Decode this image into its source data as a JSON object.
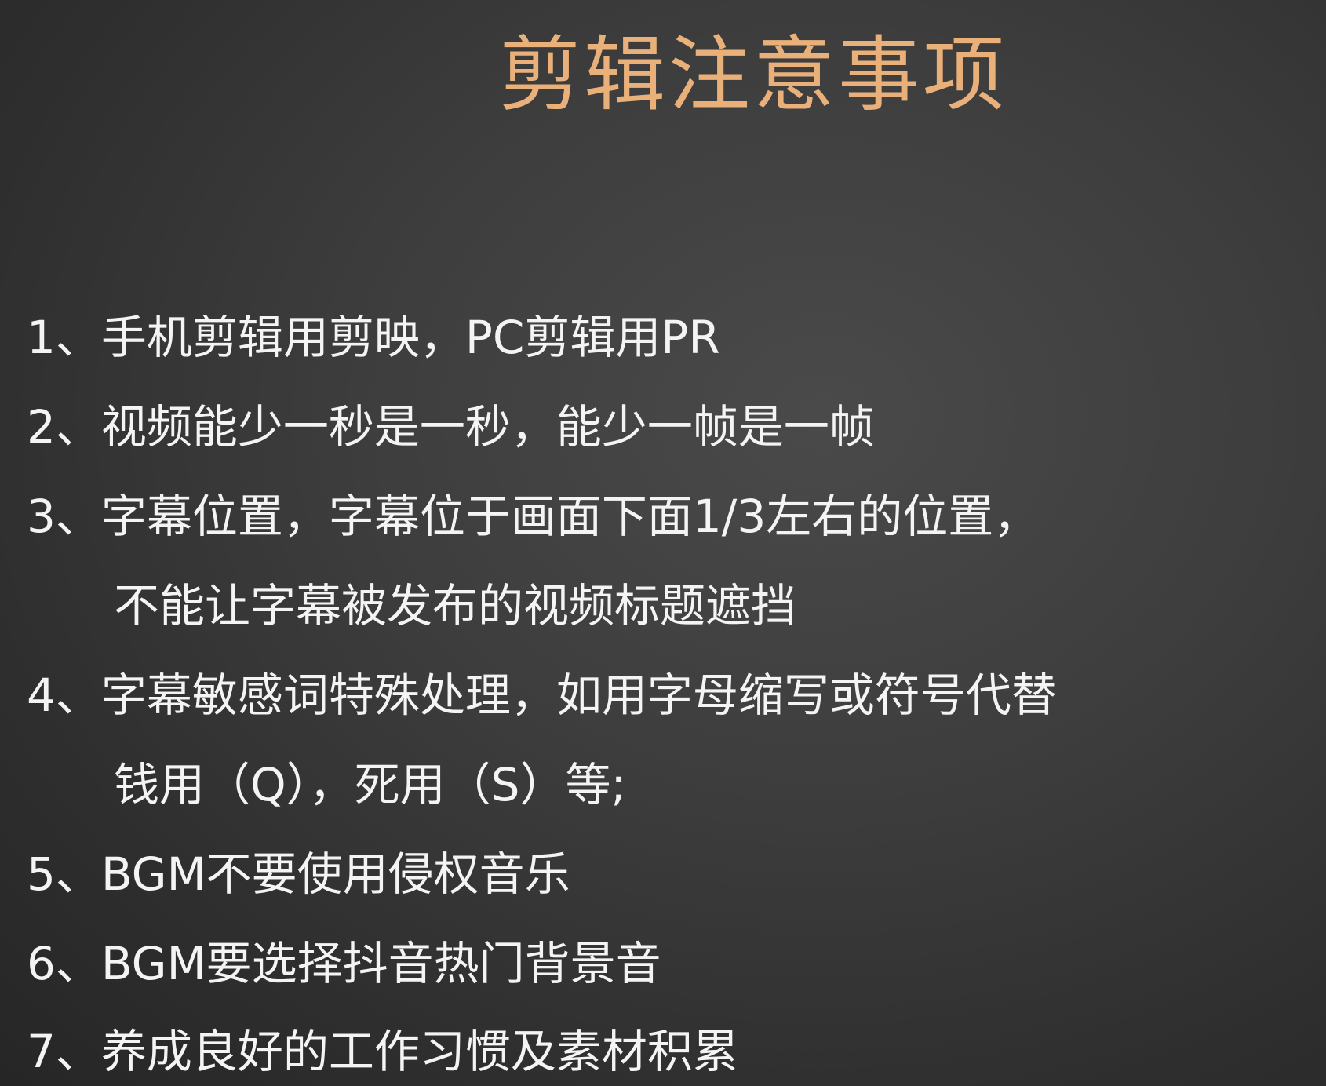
{
  "slide": {
    "title": "剪辑注意事项",
    "items": [
      {
        "text": "1、手机剪辑用剪映，PC剪辑用PR"
      },
      {
        "text": "2、视频能少一秒是一秒，能少一帧是一帧"
      },
      {
        "text": "3、字幕位置，字幕位于画面下面1/3左右的位置，"
      },
      {
        "text": "不能让字幕被发布的视频标题遮挡"
      },
      {
        "text": "4、字幕敏感词特殊处理，如用字母缩写或符号代替"
      },
      {
        "text": "钱用（Q），死用（S）等;"
      },
      {
        "text": "5、BGM不要使用侵权音乐"
      },
      {
        "text": "6、BGM要选择抖音热门背景音"
      },
      {
        "text": "7、养成良好的工作习惯及素材积累"
      }
    ]
  },
  "colors": {
    "title": "#e9b07a",
    "body_text": "#f4f4f4",
    "background": "#3a3a3a"
  }
}
